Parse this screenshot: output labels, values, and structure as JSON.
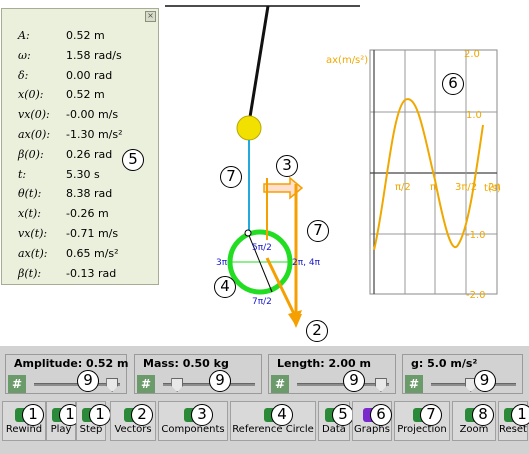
{
  "info": {
    "rows": [
      {
        "label": "A:",
        "value": "0.52 m"
      },
      {
        "label": "ω:",
        "value": "1.58 rad/s"
      },
      {
        "label": "δ:",
        "value": "0.00 rad"
      },
      {
        "label": "x(0):",
        "value": "0.52 m"
      },
      {
        "label": "vx(0):",
        "value": "-0.00 m/s"
      },
      {
        "label": "ax(0):",
        "value": "-1.30 m/s²"
      },
      {
        "label": "β(0):",
        "value": "0.26 rad"
      },
      {
        "label": "t:",
        "value": "5.30 s"
      },
      {
        "label": "θ(t):",
        "value": "8.38 rad"
      },
      {
        "label": "x(t):",
        "value": "-0.26 m"
      },
      {
        "label": "vx(t):",
        "value": "-0.71 m/s"
      },
      {
        "label": "ax(t):",
        "value": "0.65 m/s²"
      },
      {
        "label": "β(t):",
        "value": "-0.13 rad"
      }
    ]
  },
  "circle_labels": {
    "top": "5π/2",
    "left": "3π",
    "right": "2π, 4π",
    "bottom": "7π/2"
  },
  "graph": {
    "ylabel": "ax(m/s²)",
    "xlabel": "t(s)",
    "y_ticks": [
      "2.0",
      "1.0",
      "-1.0",
      "-2.0"
    ],
    "x_ticks": [
      "π/2",
      "π",
      "3π/2",
      "2π"
    ]
  },
  "annotations": {
    "info": "5",
    "pendulum": "7",
    "velocity": "3",
    "circle": "4",
    "accel": "2",
    "refline": "7",
    "graph": "6"
  },
  "sliders": [
    {
      "title": "Amplitude: 0.52 m",
      "level": 0.95
    },
    {
      "title": "Mass: 0.50 kg",
      "level": 0.1
    },
    {
      "title": "Length: 2.00 m",
      "level": 0.95
    },
    {
      "title": "g: 5.0 m/s²",
      "level": 0.45
    }
  ],
  "slider_badge": "9",
  "buttons": [
    {
      "label": "Rewind",
      "badge": "1"
    },
    {
      "label": "Play",
      "badge": "1"
    },
    {
      "label": "Step",
      "badge": "1"
    },
    {
      "label": "Vectors",
      "badge": "2"
    },
    {
      "label": "Components",
      "badge": "3"
    },
    {
      "label": "Reference Circle",
      "badge": "4"
    },
    {
      "label": "Data",
      "badge": "5"
    },
    {
      "label": "Graphs",
      "badge": "6"
    },
    {
      "label": "Projection",
      "badge": "7"
    },
    {
      "label": "Zoom",
      "badge": "8"
    },
    {
      "label": "Reset",
      "badge": "1"
    }
  ],
  "colors": {
    "accent_green": "#22dd22",
    "bob_yellow": "#f2e000",
    "arrow_orange": "#f5a000",
    "graph_orange": "#f0a800",
    "string_blue": "#22aadd"
  }
}
